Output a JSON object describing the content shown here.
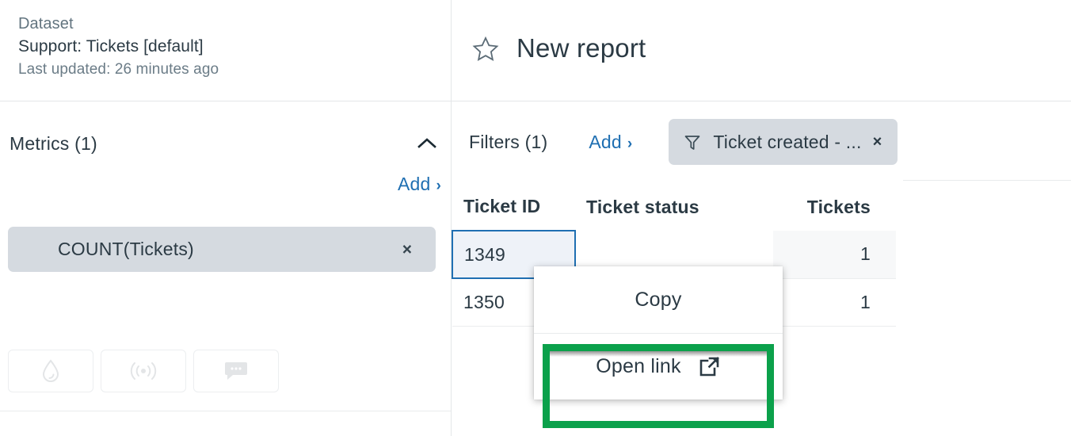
{
  "sidebar": {
    "dataset_label": "Dataset",
    "dataset_name": "Support: Tickets [default]",
    "last_updated": "Last updated: 26 minutes ago",
    "metrics": {
      "title": "Metrics (1)",
      "collapse_icon": "chevron-up-icon",
      "add_label": "Add",
      "add_chevron": "›",
      "items": [
        {
          "label": "COUNT(Tickets)",
          "remove_label": "×"
        }
      ]
    },
    "icon_buttons": [
      {
        "icon": "droplet-icon"
      },
      {
        "icon": "broadcast-icon"
      },
      {
        "icon": "chat-bubble-icon"
      }
    ]
  },
  "report": {
    "favorite_icon": "star-outline-icon",
    "title": "New report",
    "filters": {
      "title": "Filters (1)",
      "add_label": "Add",
      "add_chevron": "›",
      "chips": [
        {
          "icon": "funnel-icon",
          "label": "Ticket created - ...",
          "remove_label": "×"
        }
      ]
    },
    "table": {
      "columns": [
        {
          "key": "ticket_id",
          "header": "Ticket ID",
          "align": "left"
        },
        {
          "key": "ticket_status",
          "header": "Ticket status",
          "align": "left"
        },
        {
          "key": "tickets",
          "header": "Tickets",
          "align": "right"
        }
      ],
      "rows": [
        {
          "ticket_id": "1349",
          "ticket_status": "",
          "tickets": "1",
          "selected_cell": "ticket_id"
        },
        {
          "ticket_id": "1350",
          "ticket_status": "",
          "tickets": "1",
          "selected_cell": ""
        }
      ]
    }
  },
  "context_menu": {
    "items": [
      {
        "label": "Copy",
        "icon": ""
      },
      {
        "label": "Open link",
        "icon": "external-link-icon",
        "highlighted": true
      }
    ]
  },
  "colors": {
    "accent_blue": "#1f6fb2",
    "chip_grey": "#d5dae0",
    "text_dark": "#2b3a44",
    "text_muted": "#62747f",
    "highlight_green": "#0ba14b",
    "selected_cell_fill": "#eef2f8",
    "tinted_cell_fill": "#f7f8f9"
  }
}
